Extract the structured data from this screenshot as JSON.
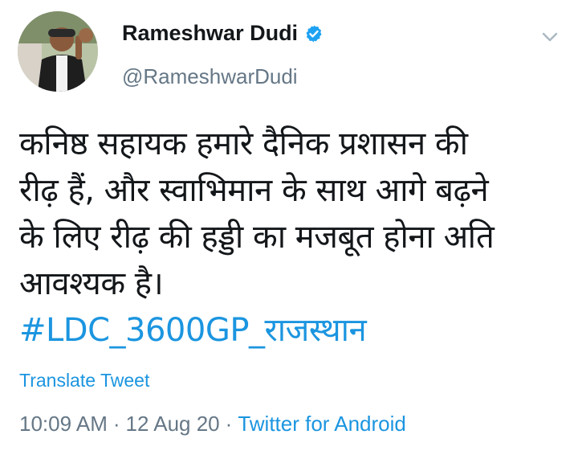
{
  "author": {
    "name": "Rameshwar Dudi",
    "handle": "@RameshwarDudi",
    "verified": true
  },
  "tweet": {
    "lines": [
      "कनिष्ठ सहायक हमारे दैनिक प्रशासन की",
      "रीढ़ हैं, और स्वाभिमान के साथ आगे बढ़ने",
      "के लिए रीढ़ की हड्डी का मजबूत होना अति",
      "आवश्यक है।"
    ],
    "hashtag": "#LDC_3600GP_राजस्थान"
  },
  "translate_label": "Translate Tweet",
  "meta": {
    "time": "10:09 AM",
    "separator": "·",
    "date": "12 Aug 20",
    "source": "Twitter for Android"
  },
  "colors": {
    "link": "#1b95e0",
    "muted": "#657786",
    "text": "#14171a"
  },
  "icons": [
    "avatar",
    "verified-badge-icon",
    "chevron-down-icon"
  ]
}
